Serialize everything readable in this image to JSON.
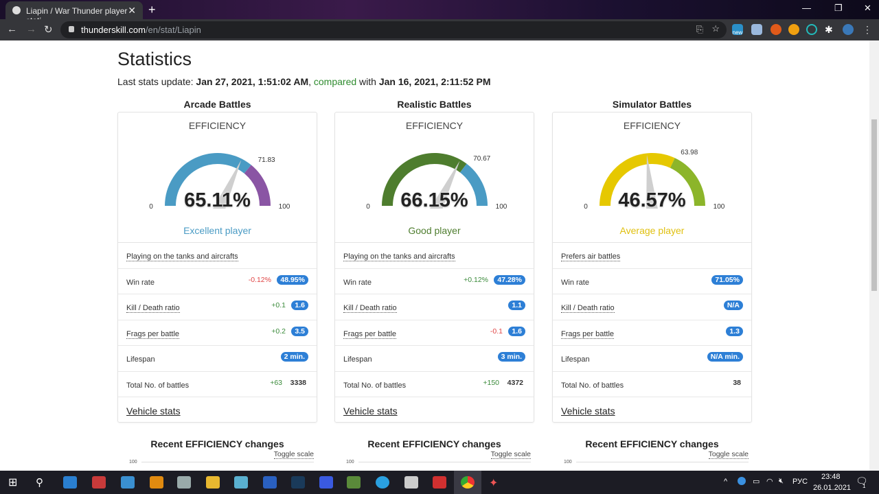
{
  "browser": {
    "tab_title": "Liapin / War Thunder player stati",
    "url_host": "thunderskill.com",
    "url_path": "/en/stat/Liapin",
    "ext_badge": "new"
  },
  "page": {
    "title": "Statistics",
    "update_label": "Last stats update:",
    "update_date": "Jan 27, 2021, 1:51:02 AM",
    "compared": "compared",
    "with": "with",
    "compared_date": "Jan 16, 2021, 2:11:52 PM"
  },
  "columns": [
    {
      "title": "Arcade Battles",
      "eff_label": "EFFICIENCY",
      "value": 65.11,
      "value_text": "65.11%",
      "threshold": 71.83,
      "threshold_text": "71.83",
      "min": "0",
      "max": "100",
      "color_a": "#4a9bc4",
      "color_b": "#8a55a4",
      "rank": "Excellent player",
      "rank_color": "#4a9bc4",
      "playstyle": "Playing on the tanks and aircrafts",
      "rows": [
        {
          "label": "Win rate",
          "change": "-0.12%",
          "sign": "neg",
          "value": "48.95%",
          "badge": true,
          "dotted": false
        },
        {
          "label": "Kill / Death ratio",
          "change": "+0.1",
          "sign": "pos",
          "value": "1.6",
          "badge": true,
          "dotted": true
        },
        {
          "label": "Frags per battle",
          "change": "+0.2",
          "sign": "pos",
          "value": "3.5",
          "badge": true,
          "dotted": true
        },
        {
          "label": "Lifespan",
          "change": "",
          "sign": "",
          "value": "2 min.",
          "badge": true,
          "dotted": false
        },
        {
          "label": "Total No. of battles",
          "change": "+63",
          "sign": "pos",
          "value": "3338",
          "badge": false,
          "dotted": false
        }
      ],
      "vehicle_stats": "Vehicle stats",
      "recent_title": "Recent EFFICIENCY changes",
      "toggle": "Toggle scale",
      "axis_top": "100"
    },
    {
      "title": "Realistic Battles",
      "eff_label": "EFFICIENCY",
      "value": 66.15,
      "value_text": "66.15%",
      "threshold": 70.67,
      "threshold_text": "70.67",
      "min": "0",
      "max": "100",
      "color_a": "#4e7d2e",
      "color_b": "#4a9bc4",
      "rank": "Good player",
      "rank_color": "#4e7d2e",
      "playstyle": "Playing on the tanks and aircrafts",
      "rows": [
        {
          "label": "Win rate",
          "change": "+0.12%",
          "sign": "pos",
          "value": "47.28%",
          "badge": true,
          "dotted": false
        },
        {
          "label": "Kill / Death ratio",
          "change": "",
          "sign": "",
          "value": "1.1",
          "badge": true,
          "dotted": true
        },
        {
          "label": "Frags per battle",
          "change": "-0.1",
          "sign": "neg",
          "value": "1.6",
          "badge": true,
          "dotted": true
        },
        {
          "label": "Lifespan",
          "change": "",
          "sign": "",
          "value": "3 min.",
          "badge": true,
          "dotted": false
        },
        {
          "label": "Total No. of battles",
          "change": "+150",
          "sign": "pos",
          "value": "4372",
          "badge": false,
          "dotted": false
        }
      ],
      "vehicle_stats": "Vehicle stats",
      "recent_title": "Recent EFFICIENCY changes",
      "toggle": "Toggle scale",
      "axis_top": "100"
    },
    {
      "title": "Simulator Battles",
      "eff_label": "EFFICIENCY",
      "value": 46.57,
      "value_text": "46.57%",
      "threshold": 63.98,
      "threshold_text": "63.98",
      "min": "0",
      "max": "100",
      "color_a": "#e6c800",
      "color_b": "#8cb52a",
      "rank": "Average player",
      "rank_color": "#e0c010",
      "playstyle": "Prefers air battles",
      "rows": [
        {
          "label": "Win rate",
          "change": "",
          "sign": "",
          "value": "71.05%",
          "badge": true,
          "dotted": false
        },
        {
          "label": "Kill / Death ratio",
          "change": "",
          "sign": "",
          "value": "N/A",
          "badge": true,
          "dotted": true
        },
        {
          "label": "Frags per battle",
          "change": "",
          "sign": "",
          "value": "1.3",
          "badge": true,
          "dotted": true
        },
        {
          "label": "Lifespan",
          "change": "",
          "sign": "",
          "value": "N/A min.",
          "badge": true,
          "dotted": false
        },
        {
          "label": "Total No. of battles",
          "change": "",
          "sign": "",
          "value": "38",
          "badge": false,
          "dotted": false
        }
      ],
      "vehicle_stats": "Vehicle stats",
      "recent_title": "Recent EFFICIENCY changes",
      "toggle": "Toggle scale",
      "axis_top": "100"
    }
  ],
  "taskbar": {
    "lang": "РУС",
    "time": "23:48",
    "date": "26.01.2021",
    "notif_count": "1"
  }
}
